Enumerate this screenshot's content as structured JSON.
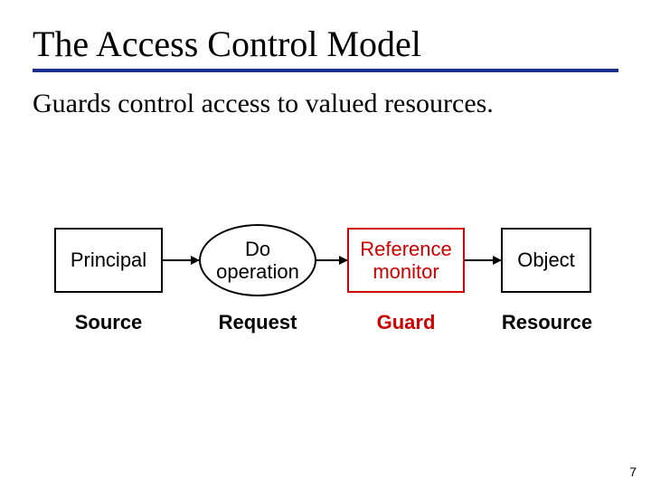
{
  "title": "The Access Control Model",
  "subtitle": "Guards control access to valued resources.",
  "page_number": "7",
  "colors": {
    "rule": "#1b2f8f",
    "accent_red": "#cc0000"
  },
  "nodes": {
    "principal": {
      "label": "Principal",
      "shape": "rect"
    },
    "operation": {
      "label": "Do\noperation",
      "shape": "oval"
    },
    "monitor": {
      "label": "Reference\nmonitor",
      "shape": "rect",
      "highlight": true
    },
    "object": {
      "label": "Object",
      "shape": "rect"
    }
  },
  "captions": {
    "source": "Source",
    "request": "Request",
    "guard": "Guard",
    "resource": "Resource"
  }
}
